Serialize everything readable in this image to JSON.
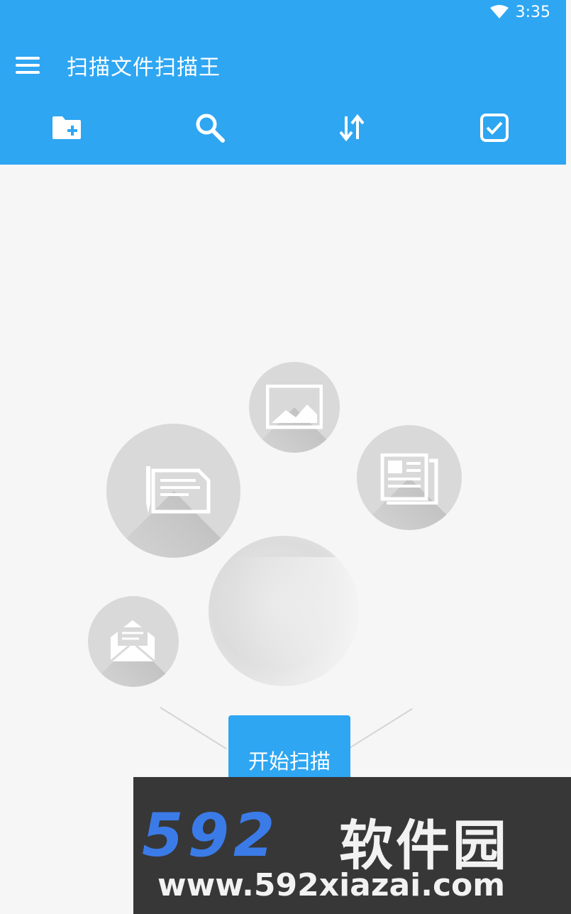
{
  "status_bar": {
    "time": "3:35",
    "wifi_icon": "wifi-icon"
  },
  "app_bar": {
    "menu_icon": "hamburger-menu-icon",
    "title": "扫描文件扫描王"
  },
  "toolbar": {
    "items": [
      {
        "icon": "new-folder-icon"
      },
      {
        "icon": "search-icon"
      },
      {
        "icon": "sort-icon"
      },
      {
        "icon": "select-checkbox-icon"
      }
    ]
  },
  "illustration": {
    "icons": [
      "image-icon",
      "document-sign-icon",
      "newspaper-icon",
      "mail-icon"
    ]
  },
  "scan_button": {
    "label": "开始扫描"
  },
  "watermark": {
    "logo": "592",
    "name": "软件园",
    "url": "www.592xiazai.com"
  },
  "colors": {
    "primary": "#2ea6f2",
    "background": "#f6f6f6",
    "circle": "#d9d9d9",
    "watermark_bg": "#373737",
    "watermark_logo": "#3b7be8"
  }
}
